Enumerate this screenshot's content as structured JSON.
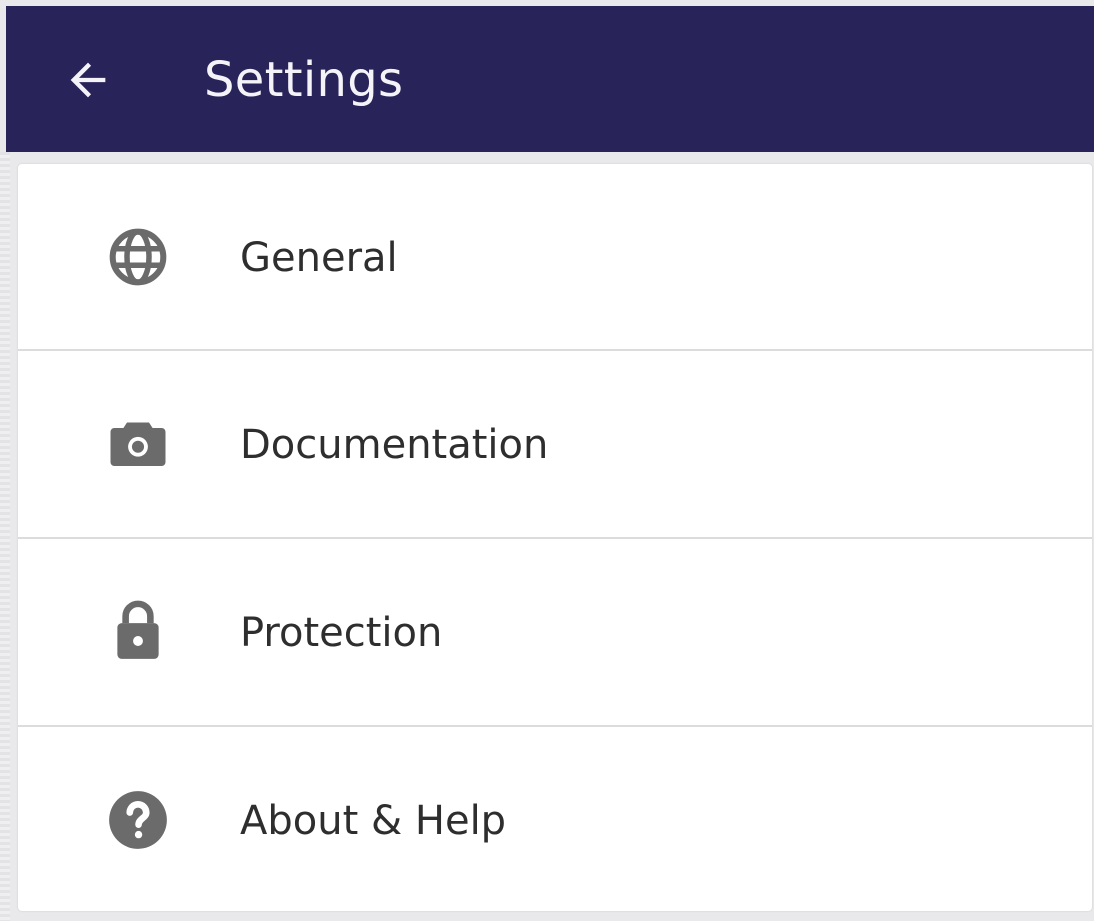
{
  "header": {
    "title": "Settings",
    "back_icon": "arrow-left-icon",
    "background": "#28245a"
  },
  "menu": {
    "items": [
      {
        "label": "General",
        "icon": "globe-icon"
      },
      {
        "label": "Documentation",
        "icon": "camera-icon"
      },
      {
        "label": "Protection",
        "icon": "lock-icon"
      },
      {
        "label": "About & Help",
        "icon": "help-circle-icon"
      }
    ],
    "icon_color": "#6b6b6b"
  }
}
